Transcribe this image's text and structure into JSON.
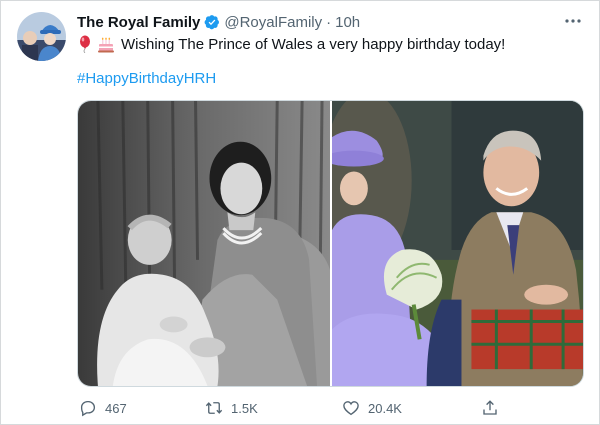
{
  "tweet": {
    "display_name": "The Royal Family",
    "handle": "@RoyalFamily",
    "separator": "·",
    "time": "10h",
    "emojis": [
      "balloon-icon",
      "birthday-cake-icon"
    ],
    "text": "Wishing The Prince of Wales a very happy birthday today!",
    "hashtag": "#HappyBirthdayHRH"
  },
  "media": [
    {
      "kind": "photo",
      "subject": "black-and-white-portrait"
    },
    {
      "kind": "photo",
      "subject": "colour-outdoor-photo"
    }
  ],
  "actions": {
    "reply_count": "467",
    "retweet_count": "1.5K",
    "like_count": "20.4K"
  },
  "icons": {
    "verified": "verified-badge-icon",
    "more": "more-options-icon",
    "reply": "reply-icon",
    "retweet": "retweet-icon",
    "like": "like-icon",
    "share": "share-icon"
  },
  "colors": {
    "accent": "#1d9bf0",
    "text": "#0f1419",
    "muted": "#536471",
    "border": "#cfd9de"
  }
}
